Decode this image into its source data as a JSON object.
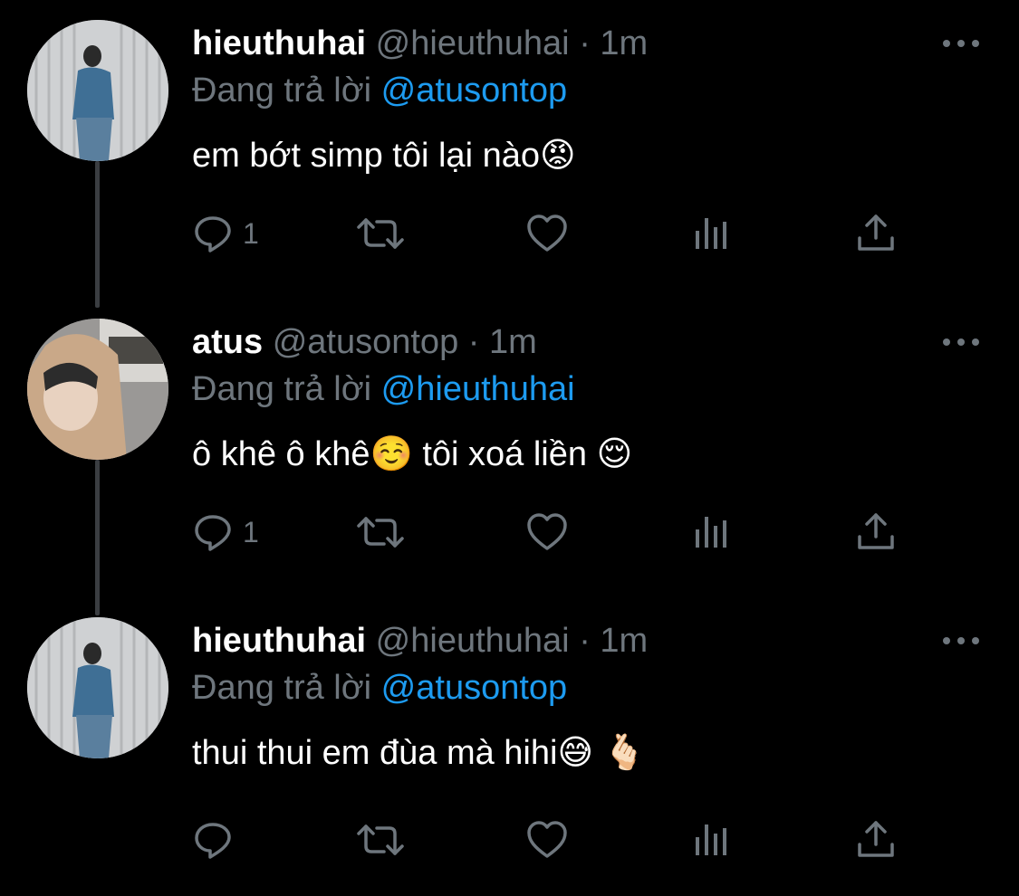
{
  "colors": {
    "background": "#000000",
    "secondary_text": "#6e767d",
    "link": "#1d9bf0",
    "thread_line": "#3a3d41"
  },
  "tweets": [
    {
      "display_name": "hieuthuhai",
      "handle": "@hieuthuhai",
      "separator": "·",
      "time": "1m",
      "reply_prefix": "Đang trả lời",
      "reply_to": "@atusontop",
      "text": "em bớt simp tôi lại nào😡",
      "reply_count": "1",
      "avatar_icon": "profile-photo-standing-man"
    },
    {
      "display_name": "atus",
      "handle": "@atusontop",
      "separator": "·",
      "time": "1m",
      "reply_prefix": "Đang trả lời",
      "reply_to": "@hieuthuhai",
      "text": "ô khê ô khê☺️  tôi xoá liền 😌",
      "reply_count": "1",
      "avatar_icon": "profile-photo-hoodie-selfie"
    },
    {
      "display_name": "hieuthuhai",
      "handle": "@hieuthuhai",
      "separator": "·",
      "time": "1m",
      "reply_prefix": "Đang trả lời",
      "reply_to": "@atusontop",
      "text": "thui thui em đùa mà hihi😅 🫰🏻",
      "reply_count": "",
      "avatar_icon": "profile-photo-standing-man"
    }
  ],
  "action_icons": [
    "reply-icon",
    "retweet-icon",
    "like-icon",
    "analytics-icon",
    "share-icon"
  ]
}
